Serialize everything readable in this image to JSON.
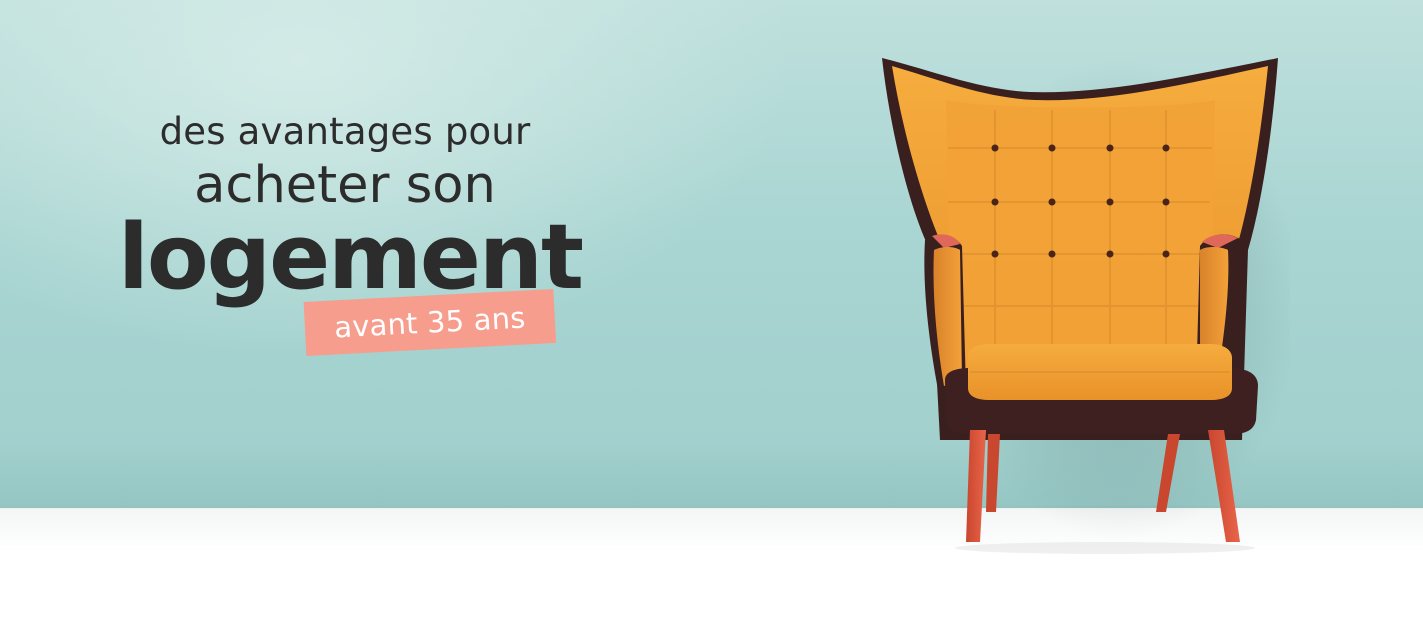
{
  "headline": {
    "line1": "des avantages pour",
    "line2": "acheter son",
    "line3": "logement",
    "badge": "avant 35 ans"
  },
  "colors": {
    "wall": "#a9d5d2",
    "floor": "#ffffff",
    "text": "#2c2c2c",
    "badge_bg": "#f79d8d",
    "badge_text": "#ffffff",
    "chair_fabric": "#f1a033",
    "chair_frame": "#3a1f1f",
    "chair_legs": "#d9573f"
  },
  "image": {
    "subject": "armchair-illustration"
  }
}
